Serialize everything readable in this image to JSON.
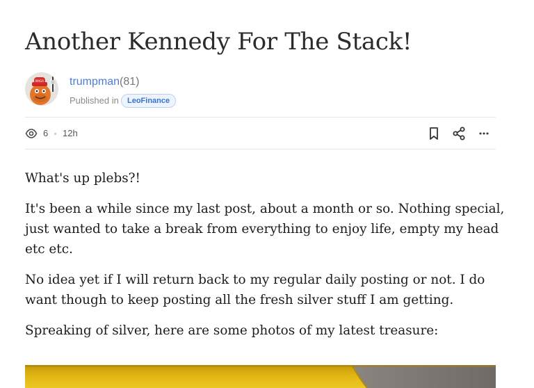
{
  "post": {
    "title": "Another Kennedy For The Stack!"
  },
  "author": {
    "name": "trumpman",
    "reputation": "(81)",
    "published_label": "Published in",
    "community": "LeoFinance",
    "avatar_icon": "avatar-image"
  },
  "meta": {
    "views_icon": "eye-icon",
    "views": "6",
    "age": "12h"
  },
  "actions": {
    "bookmark_icon": "bookmark-icon",
    "share_icon": "share-icon",
    "more_icon": "more-options-icon"
  },
  "body": {
    "paragraphs": [
      "What's up plebs?!",
      "It's been a while since my last post, about a month or so. Nothing special, just wanted to take a break from everything to enjoy life, empty my head etc etc.",
      "No idea yet if I will return back to my regular daily posting or not. I do want though to keep posting all the fresh silver stuff I am getting.",
      "Spreaking of silver, here are some photos of my latest treasure:"
    ]
  },
  "colors": {
    "link": "#4a7dd4",
    "badge_text": "#3a72c9",
    "badge_bg": "#eef4fd",
    "photo_yellow": "#e2b714",
    "photo_gray": "#7f7b76"
  }
}
